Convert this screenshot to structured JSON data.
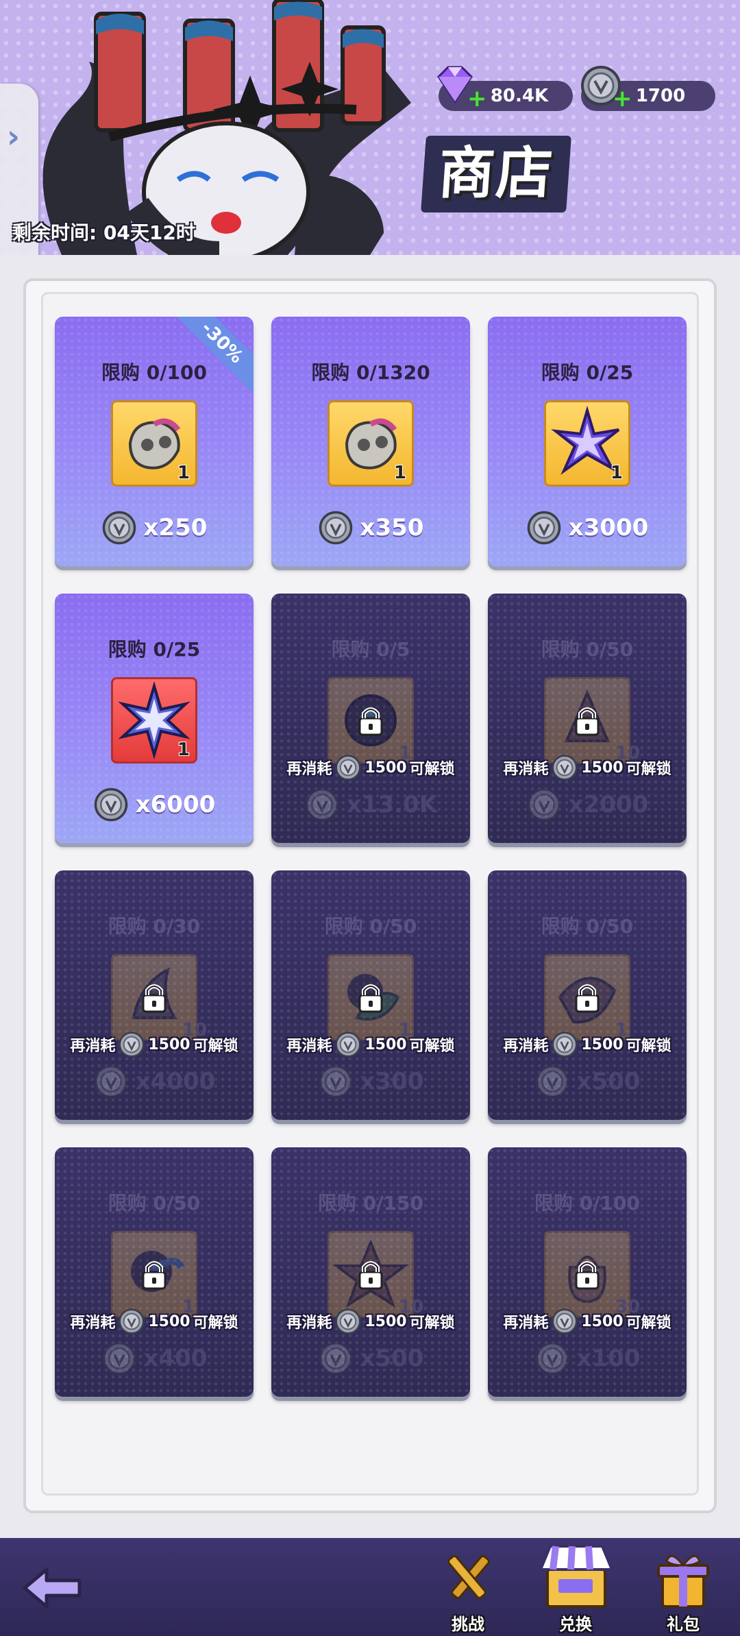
{
  "header": {
    "title": "商店",
    "timer": "剩余时间: 04天12时",
    "gems": "80.4K",
    "coins": "1700"
  },
  "cards": [
    {
      "limit": "限购 0/100",
      "qty": "1",
      "price": "x250",
      "discount": "-30%",
      "locked": false,
      "item": "mask"
    },
    {
      "limit": "限购 0/1320",
      "qty": "1",
      "price": "x350",
      "locked": false,
      "item": "mask"
    },
    {
      "limit": "限购 0/25",
      "qty": "1",
      "price": "x3000",
      "locked": false,
      "item": "star-crystal"
    },
    {
      "limit": "限购 0/25",
      "qty": "1",
      "price": "x6000",
      "locked": false,
      "item": "snowflake"
    },
    {
      "limit": "限购 0/5",
      "qty": "1",
      "price": "x13.0K",
      "locked": true,
      "item": "dark-orb"
    },
    {
      "limit": "限购 0/50",
      "qty": "10",
      "price": "x2000",
      "locked": true,
      "item": "hat"
    },
    {
      "limit": "限购 0/30",
      "qty": "10",
      "price": "x4000",
      "locked": true,
      "item": "claw"
    },
    {
      "limit": "限购 0/50",
      "qty": "1",
      "price": "x300",
      "locked": true,
      "item": "leaf-orb"
    },
    {
      "limit": "限购 0/50",
      "qty": "1",
      "price": "x500",
      "locked": true,
      "item": "wing"
    },
    {
      "limit": "限购 0/50",
      "qty": "1",
      "price": "x400",
      "locked": true,
      "item": "feather-orb"
    },
    {
      "limit": "限购 0/150",
      "qty": "10",
      "price": "x500",
      "locked": true,
      "item": "star"
    },
    {
      "limit": "限购 0/100",
      "qty": "30",
      "price": "x100",
      "locked": true,
      "item": "bag"
    }
  ],
  "unlock": {
    "prefix": "再消耗",
    "amount": "1500",
    "suffix": "可解锁"
  },
  "nav": {
    "challenge": "挑战",
    "exchange": "兑换",
    "gift": "礼包"
  },
  "colors": {
    "accent": "#8a6df0",
    "locked": "#2f2b55",
    "nav": "#3e3570"
  }
}
